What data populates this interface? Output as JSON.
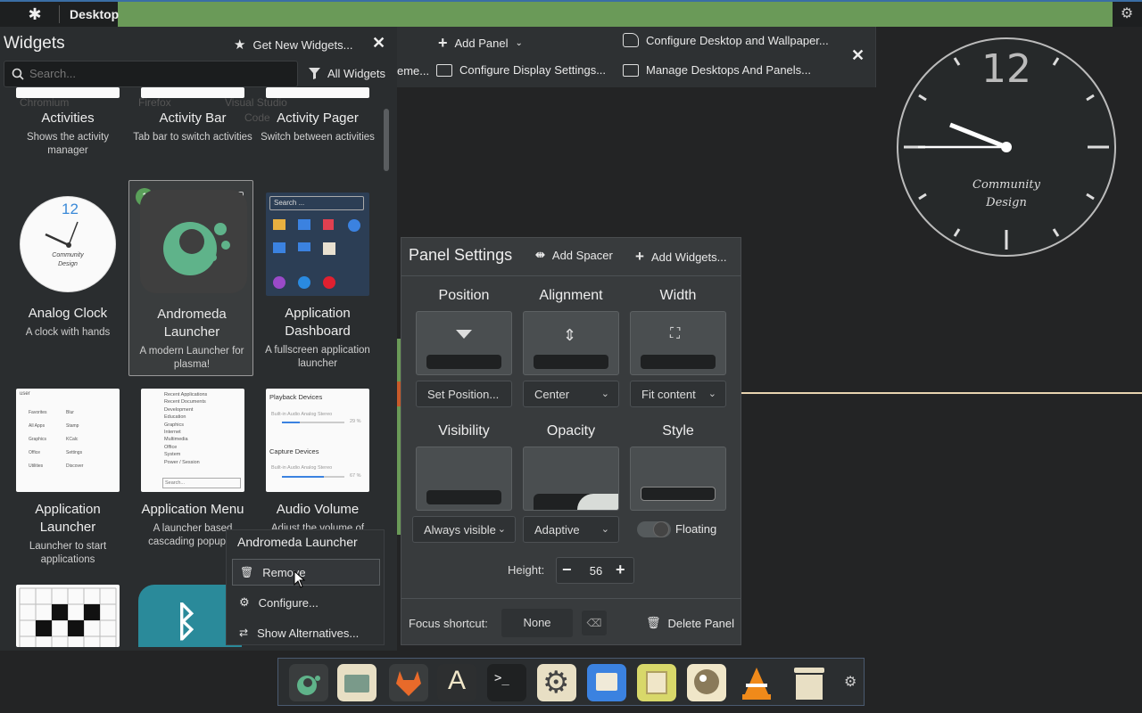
{
  "topbar": {
    "title": "Desktop"
  },
  "widgets": {
    "header": "Widgets",
    "get_new": "Get New Widgets...",
    "search_placeholder": "Search...",
    "filter": "All Widgets",
    "items": [
      {
        "name": "Activities",
        "desc": "Shows the activity manager"
      },
      {
        "name": "Activity Bar",
        "desc": "Tab bar to switch activities"
      },
      {
        "name": "Activity Pager",
        "desc": "Switch between activities"
      },
      {
        "name": "Analog Clock",
        "desc": "A clock with hands"
      },
      {
        "name": "Andromeda Launcher",
        "desc": "A modern Launcher for plasma!",
        "badge": "1"
      },
      {
        "name": "Application Dashboard",
        "desc": "A fullscreen application launcher"
      },
      {
        "name": "Application Launcher",
        "desc": "Launcher to start applications"
      },
      {
        "name": "Application Menu",
        "desc": "A launcher based cascading popup m"
      },
      {
        "name": "Audio Volume",
        "desc": "Adjust the volume of"
      }
    ],
    "behind_labels": [
      "Chromium",
      "Firefox",
      "Visual Studio",
      "Code"
    ],
    "thumb_search": "Search ...",
    "clock_text": [
      "12",
      "Community",
      "Design"
    ],
    "appmenu_items": [
      "Recent Applications",
      "Recent Documents",
      "Development",
      "Education",
      "Graphics",
      "Internet",
      "Multimedia",
      "Office",
      "System",
      "Power / Session"
    ],
    "appmenu_search": "Search...",
    "audio": {
      "playback": "Playback Devices",
      "playback_device": "Built-in Audio Analog Stereo",
      "playback_pct": "29 %",
      "capture": "Capture Devices",
      "capture_device": "Built-in Audio Analog Stereo",
      "capture_pct": "67 %"
    },
    "launcher_sidebar": [
      "Favorites",
      "All Apps",
      "Graphics",
      "Office",
      "Utilities"
    ],
    "launcher_items": [
      "Blur",
      "Stamp",
      "KCalc",
      "Settings",
      "Discover"
    ]
  },
  "toolbar": {
    "add_panel": "Add Panel",
    "theme_partial": "eme...",
    "configure_display": "Configure Display Settings...",
    "configure_desktop": "Configure Desktop and Wallpaper...",
    "manage_desktops": "Manage Desktops And Panels..."
  },
  "clock": {
    "twelve": "12",
    "line1": "Community",
    "line2": "Design"
  },
  "panel_settings": {
    "title": "Panel Settings",
    "add_spacer": "Add Spacer",
    "add_widgets": "Add Widgets...",
    "position": "Position",
    "alignment": "Alignment",
    "width": "Width",
    "set_position": "Set Position...",
    "alignment_value": "Center",
    "width_value": "Fit content",
    "visibility": "Visibility",
    "opacity": "Opacity",
    "style": "Style",
    "visibility_value": "Always visible",
    "opacity_value": "Adaptive",
    "floating": "Floating",
    "height_label": "Height:",
    "height_value": "56",
    "focus_label": "Focus shortcut:",
    "focus_value": "None",
    "delete": "Delete Panel"
  },
  "context_menu": {
    "title": "Andromeda Launcher",
    "remove": "Remove",
    "configure": "Configure...",
    "alternatives": "Show Alternatives..."
  },
  "dock": {
    "apps": [
      "andromeda-launcher",
      "file-manager",
      "gitlab",
      "text-editor",
      "terminal",
      "settings",
      "screenshot",
      "image-viewer",
      "gimp",
      "vlc",
      "trash"
    ]
  }
}
